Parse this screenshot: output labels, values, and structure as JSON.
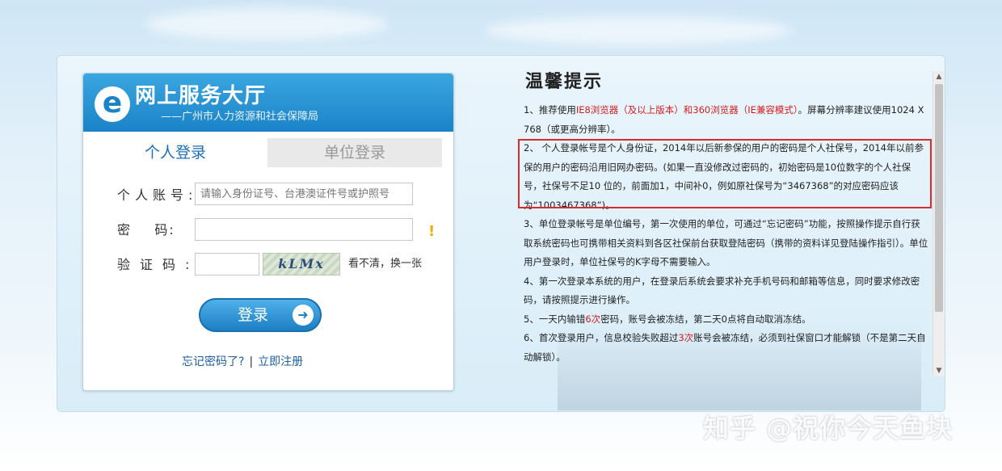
{
  "logo": {
    "mark": "e",
    "title": "网上服务大厅",
    "subtitle": "——广州市人力资源和社会保障局"
  },
  "tabs": [
    {
      "label": "个人登录",
      "active": true
    },
    {
      "label": "单位登录",
      "active": false
    }
  ],
  "form": {
    "account_label": "个人账号:",
    "account_placeholder": "请输入身份证号、台港澳证件号或护照号",
    "password_label": "密    码:",
    "captcha_label": "验证码:",
    "captcha_text": "kLMx",
    "captcha_refresh": "看不清，换一张",
    "login_button": "登录",
    "forgot": "忘记密码了?",
    "separator": "|",
    "register": "立即注册"
  },
  "notice": {
    "title": "温馨提示",
    "item1_a": "1、推荐使用",
    "item1_red": "IE8浏览器（及以上版本）和360浏览器（IE兼容模式）",
    "item1_b": "。屏幕分辨率建议使用1024 X 768（或更高分辨率）。",
    "item2": "2、 个人登录帐号是个人身份证，2014年以后新参保的用户的密码是个人社保号，2014年以前参保的用户的密码沿用旧网办密码。(如果一直没修改过密码的，初始密码是10位数字的个人社保号，社保号不足10 位的，前面加1，中间补0，例如原社保号为“3467368”的对应密码应该为“1003467368”)。",
    "item3": "3、单位登录帐号是单位编号，第一次使用的单位，可通过“忘记密码”功能，按照操作提示自行获取系统密码也可携带相关资料到各区社保前台获取登陆密码（携带的资料详见登陆操作指引）。单位用户登录时，单位社保号的K字母不需要输入。",
    "item4": "4、第一次登录本系统的用户，在登录后系统会要求补充手机号码和邮箱等信息，同时要求修改密码，请按照提示进行操作。",
    "item5_a": "5、一天内输错",
    "item5_red": "6次",
    "item5_b": "密码，账号会被冻结，第二天0点将自动取消冻结。",
    "item6_a": "6、首次登录用户，信息校验失败超过",
    "item6_red": "3次",
    "item6_b": "账号会被冻结，必须到社保窗口才能解锁（不是第二天自动解锁）。"
  },
  "scrollbar": {
    "up": "▲",
    "down": "▼"
  },
  "watermark": "知乎 @祝你今天鱼块",
  "colors": {
    "brand_blue": "#1b83c8",
    "highlight_red": "#d92b2b",
    "warning": "#f2a900"
  }
}
